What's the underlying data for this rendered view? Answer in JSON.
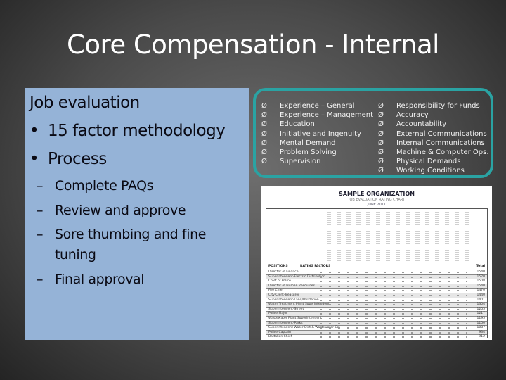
{
  "slide": {
    "title": "Core Compensation - Internal",
    "left_panel": {
      "heading": "Job evaluation",
      "bullets": [
        "15 factor methodology",
        "Process"
      ],
      "sub_items": [
        "Complete PAQs",
        "Review and approve",
        "Sore thumbing and fine tuning",
        "Final approval"
      ],
      "bullet_glyph": "•",
      "dash_glyph": "–"
    },
    "factors": {
      "arrow_glyph": "Ø",
      "column1": [
        "Experience – General",
        "Experience – Management",
        "Education",
        "Initiative and Ingenuity",
        "Mental Demand",
        "Problem Solving",
        "Supervision"
      ],
      "column2": [
        "Responsibility for Funds",
        "Accuracy",
        "Accountability",
        "External Communications",
        "Internal Communications",
        "Machine & Computer Ops.",
        "Physical Demands",
        "Working Conditions"
      ]
    },
    "chart_image": {
      "title": "SAMPLE ORGANIZATION",
      "subtitle": "JOB EVALUATION RATING CHART",
      "date": "JUNE 2011",
      "col_positions": "POSITIONS",
      "col_rating_factors": "RATING FACTORS",
      "col_total": "Total",
      "rows": [
        {
          "position": "Director of Finance",
          "total": "1540"
        },
        {
          "position": "Superintendent-Electric Distribution",
          "total": "1570"
        },
        {
          "position": "Chief of Police",
          "total": "1508"
        },
        {
          "position": "Director of Human Resources",
          "total": "1540"
        },
        {
          "position": "Fire Chief",
          "total": "1470"
        },
        {
          "position": "City Clerk-Treasurer",
          "total": "1440"
        },
        {
          "position": "Superintendent-Land/Utilization",
          "total": "1401"
        },
        {
          "position": "Water Treatment Plant Superintendent",
          "total": "1304"
        },
        {
          "position": "Superintendent-Street",
          "total": "1255"
        },
        {
          "position": "Police Major",
          "total": "1217"
        },
        {
          "position": "Wastewater Plant Superintendent",
          "total": "1195"
        },
        {
          "position": "Superintendent-Parks",
          "total": "1150"
        },
        {
          "position": "Superintendent-Water Dist & Wastewater Col",
          "total": "1087"
        },
        {
          "position": "Police Captain",
          "total": "934"
        },
        {
          "position": "Battalion Chief",
          "total": "912"
        }
      ]
    },
    "colors": {
      "left_panel_bg": "#95b3d7",
      "factor_border": "#2aa3a3"
    }
  }
}
